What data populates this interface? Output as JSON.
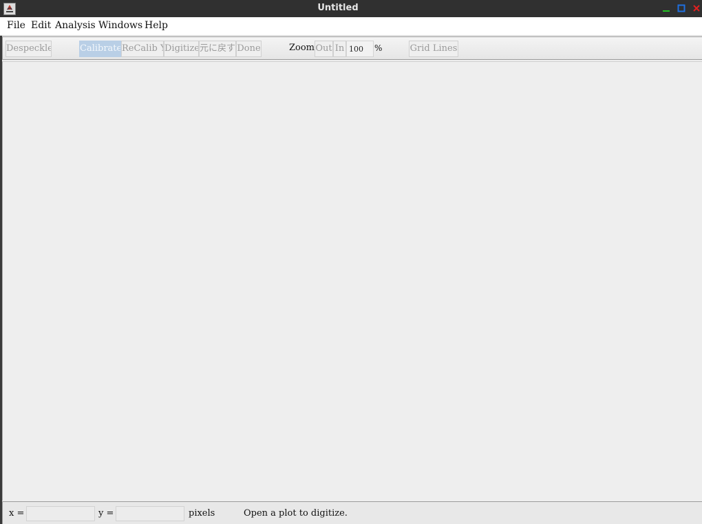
{
  "window": {
    "title": "Untitled",
    "icon": "java-app-icon",
    "controls": [
      "minimize-icon",
      "maximize-icon",
      "close-icon"
    ],
    "control_colors": {
      "minimize": "#22c322",
      "maximize": "#1e6fe0",
      "close": "#e02020"
    }
  },
  "menubar": {
    "items": [
      {
        "label": "File"
      },
      {
        "label": "Edit"
      },
      {
        "label": "Analysis"
      },
      {
        "label": "Windows"
      },
      {
        "label": "Help"
      }
    ]
  },
  "toolbar": {
    "despeckle": "Despeckle",
    "calibrate": "Calibrate",
    "recalib_y": "ReCalib Y",
    "digitize": "Digitize",
    "undo": "元に戻す",
    "done": "Done",
    "zoom_label": "Zoom:",
    "zoom_out": "Out",
    "zoom_in": "In",
    "zoom_value": "100",
    "zoom_unit": "%",
    "grid_lines": "Grid Lines",
    "active_color": "#b9cfe6"
  },
  "statusbar": {
    "x_label": "x =",
    "x_value": "",
    "y_label": "y =",
    "y_value": "",
    "units": "pixels",
    "message": "Open a plot to digitize."
  }
}
